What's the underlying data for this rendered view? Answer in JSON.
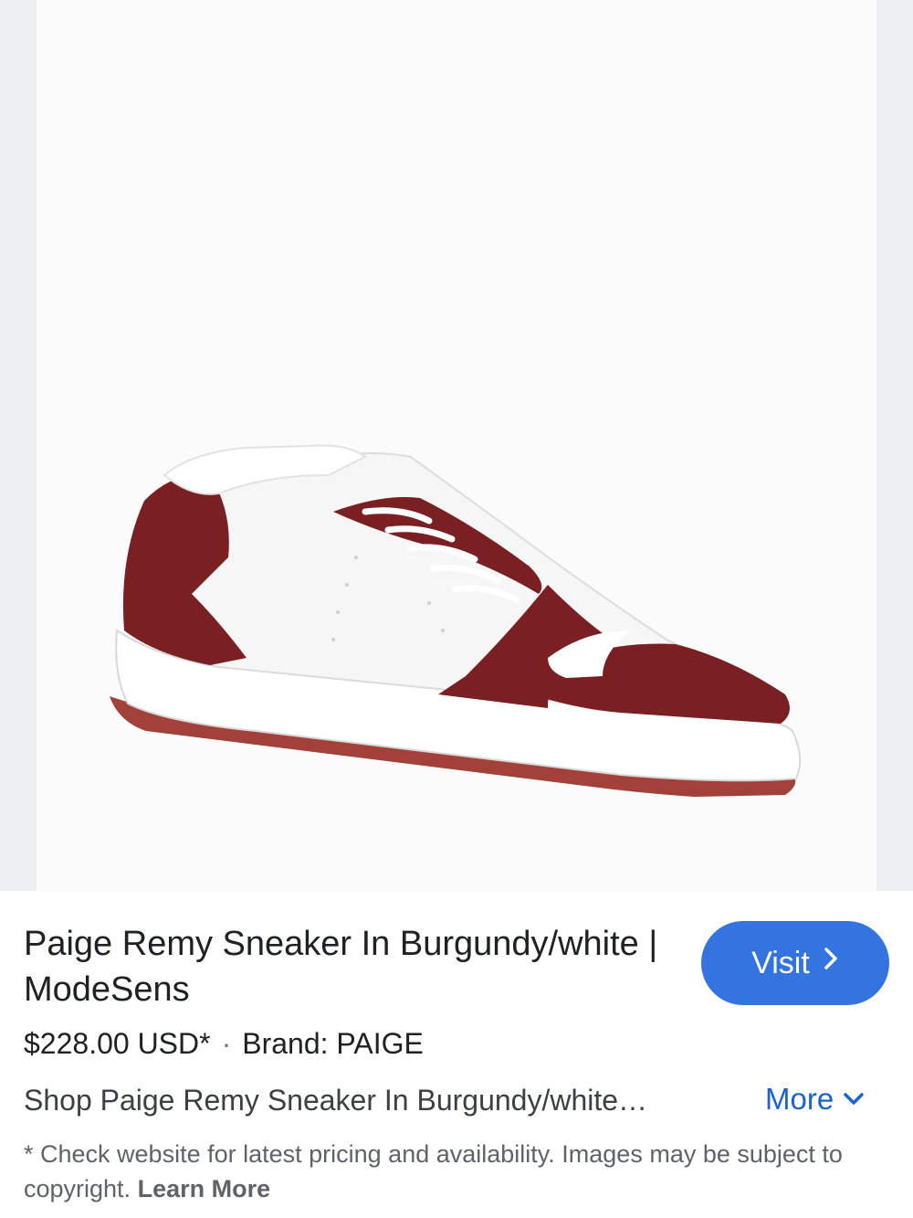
{
  "product_image": {
    "alt": "Paige Remy Sneaker In Burgundy/white"
  },
  "product": {
    "title": "Paige Remy Sneaker In Burgundy/white | ModeSens",
    "price": "$228.00 USD*",
    "separator": "·",
    "brand": "Brand: PAIGE",
    "snippet": "Shop Paige Remy Sneaker In Burgundy/white…"
  },
  "actions": {
    "visit_label": "Visit",
    "more_label": "More"
  },
  "disclaimer": {
    "text": "* Check website for latest pricing and availability. Images may be subject to copyright.",
    "learn_more": "Learn More"
  },
  "colors": {
    "accent": "#3474e0",
    "link": "#1a63d1",
    "shoe_burgundy": "#7a1f22",
    "sole_red": "#a2413a"
  },
  "icons": {
    "visit_chevron": "chevron-right-icon",
    "more_chevron": "chevron-down-icon"
  }
}
